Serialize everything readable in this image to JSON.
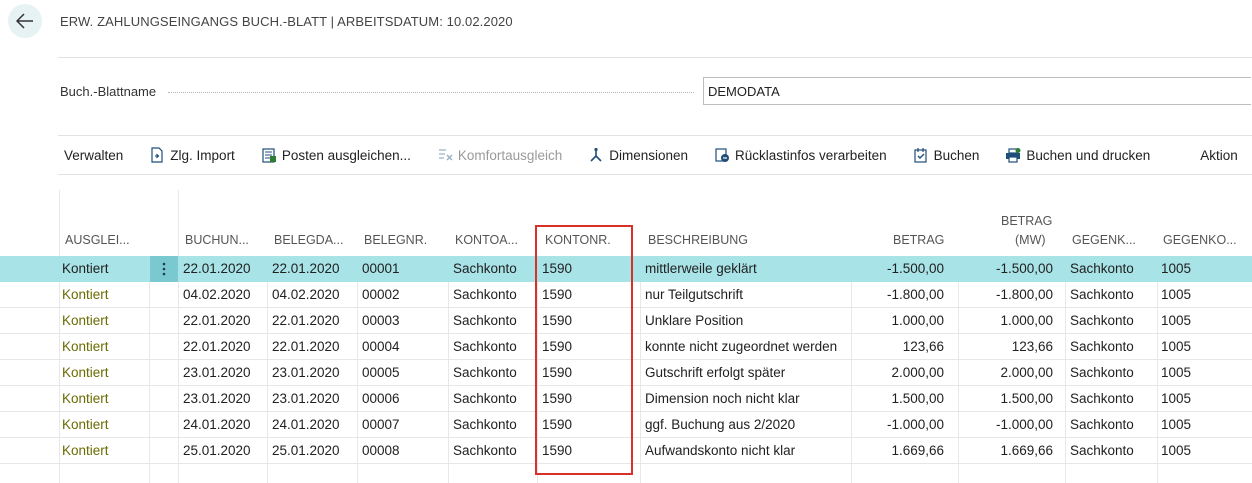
{
  "page": {
    "title": "ERW. ZAHLUNGSEINGANGS BUCH.-BLATT | ARBEITSDATUM: 10.02.2020"
  },
  "field": {
    "label": "Buch.-Blattname",
    "value": "DEMODATA"
  },
  "actions": [
    {
      "label": "Verwalten",
      "icon": ""
    },
    {
      "label": "Zlg. Import",
      "icon": "import-icon"
    },
    {
      "label": "Posten ausgleichen...",
      "icon": "apply-entries-icon"
    },
    {
      "label": "Komfortausgleich",
      "icon": "comfort-apply-icon"
    },
    {
      "label": "Dimensionen",
      "icon": "dimensions-icon"
    },
    {
      "label": "Rücklastinfos verarbeiten",
      "icon": "return-info-icon"
    },
    {
      "label": "Buchen",
      "icon": "post-icon"
    },
    {
      "label": "Buchen und drucken",
      "icon": "post-print-icon"
    },
    {
      "label": "Aktion",
      "icon": ""
    }
  ],
  "columns": {
    "ausgleich": "AUSGLEI...",
    "buchungsdatum": "BUCHUN...",
    "belegdatum": "BELEGDA...",
    "belegnr": "BELEGNR.",
    "kontoart": "KONTOA...",
    "kontonr": "KONTONR.",
    "beschreibung": "BESCHREIBUNG",
    "betrag": "BETRAG",
    "betrag_mw_1": "BETRAG",
    "betrag_mw_2": "(MW)",
    "gegenkontoart": "GEGENK...",
    "gegenkontonr": "GEGENKO..."
  },
  "rows": [
    {
      "status": "Kontiert",
      "buchungsdatum": "22.01.2020",
      "belegdatum": "22.01.2020",
      "belegnr": "00001",
      "kontoart": "Sachkonto",
      "kontonr": "1590",
      "beschreibung": "mittlerweile geklärt",
      "betrag": "-1.500,00",
      "betrag_mw": "-1.500,00",
      "gegenkontoart": "Sachkonto",
      "gegenkontonr": "1005"
    },
    {
      "status": "Kontiert",
      "buchungsdatum": "04.02.2020",
      "belegdatum": "04.02.2020",
      "belegnr": "00002",
      "kontoart": "Sachkonto",
      "kontonr": "1590",
      "beschreibung": "nur Teilgutschrift",
      "betrag": "-1.800,00",
      "betrag_mw": "-1.800,00",
      "gegenkontoart": "Sachkonto",
      "gegenkontonr": "1005"
    },
    {
      "status": "Kontiert",
      "buchungsdatum": "22.01.2020",
      "belegdatum": "22.01.2020",
      "belegnr": "00003",
      "kontoart": "Sachkonto",
      "kontonr": "1590",
      "beschreibung": "Unklare Position",
      "betrag": "1.000,00",
      "betrag_mw": "1.000,00",
      "gegenkontoart": "Sachkonto",
      "gegenkontonr": "1005"
    },
    {
      "status": "Kontiert",
      "buchungsdatum": "22.01.2020",
      "belegdatum": "22.01.2020",
      "belegnr": "00004",
      "kontoart": "Sachkonto",
      "kontonr": "1590",
      "beschreibung": "konnte nicht zugeordnet werden",
      "betrag": "123,66",
      "betrag_mw": "123,66",
      "gegenkontoart": "Sachkonto",
      "gegenkontonr": "1005"
    },
    {
      "status": "Kontiert",
      "buchungsdatum": "23.01.2020",
      "belegdatum": "23.01.2020",
      "belegnr": "00005",
      "kontoart": "Sachkonto",
      "kontonr": "1590",
      "beschreibung": "Gutschrift erfolgt später",
      "betrag": "2.000,00",
      "betrag_mw": "2.000,00",
      "gegenkontoart": "Sachkonto",
      "gegenkontonr": "1005"
    },
    {
      "status": "Kontiert",
      "buchungsdatum": "23.01.2020",
      "belegdatum": "23.01.2020",
      "belegnr": "00006",
      "kontoart": "Sachkonto",
      "kontonr": "1590",
      "beschreibung": "Dimension noch nicht klar",
      "betrag": "1.500,00",
      "betrag_mw": "1.500,00",
      "gegenkontoart": "Sachkonto",
      "gegenkontonr": "1005"
    },
    {
      "status": "Kontiert",
      "buchungsdatum": "24.01.2020",
      "belegdatum": "24.01.2020",
      "belegnr": "00007",
      "kontoart": "Sachkonto",
      "kontonr": "1590",
      "beschreibung": "ggf. Buchung aus 2/2020",
      "betrag": "-1.000,00",
      "betrag_mw": "-1.000,00",
      "gegenkontoart": "Sachkonto",
      "gegenkontonr": "1005"
    },
    {
      "status": "Kontiert",
      "buchungsdatum": "25.01.2020",
      "belegdatum": "25.01.2020",
      "belegnr": "00008",
      "kontoart": "Sachkonto",
      "kontonr": "1590",
      "beschreibung": "Aufwandskonto nicht klar",
      "betrag": "1.669,66",
      "betrag_mw": "1.669,66",
      "gegenkontoart": "Sachkonto",
      "gegenkontonr": "1005"
    }
  ],
  "colors": {
    "selected_row": "#a8e3e7",
    "status_text": "#6b6b00",
    "highlight_box": "#d9302a"
  }
}
